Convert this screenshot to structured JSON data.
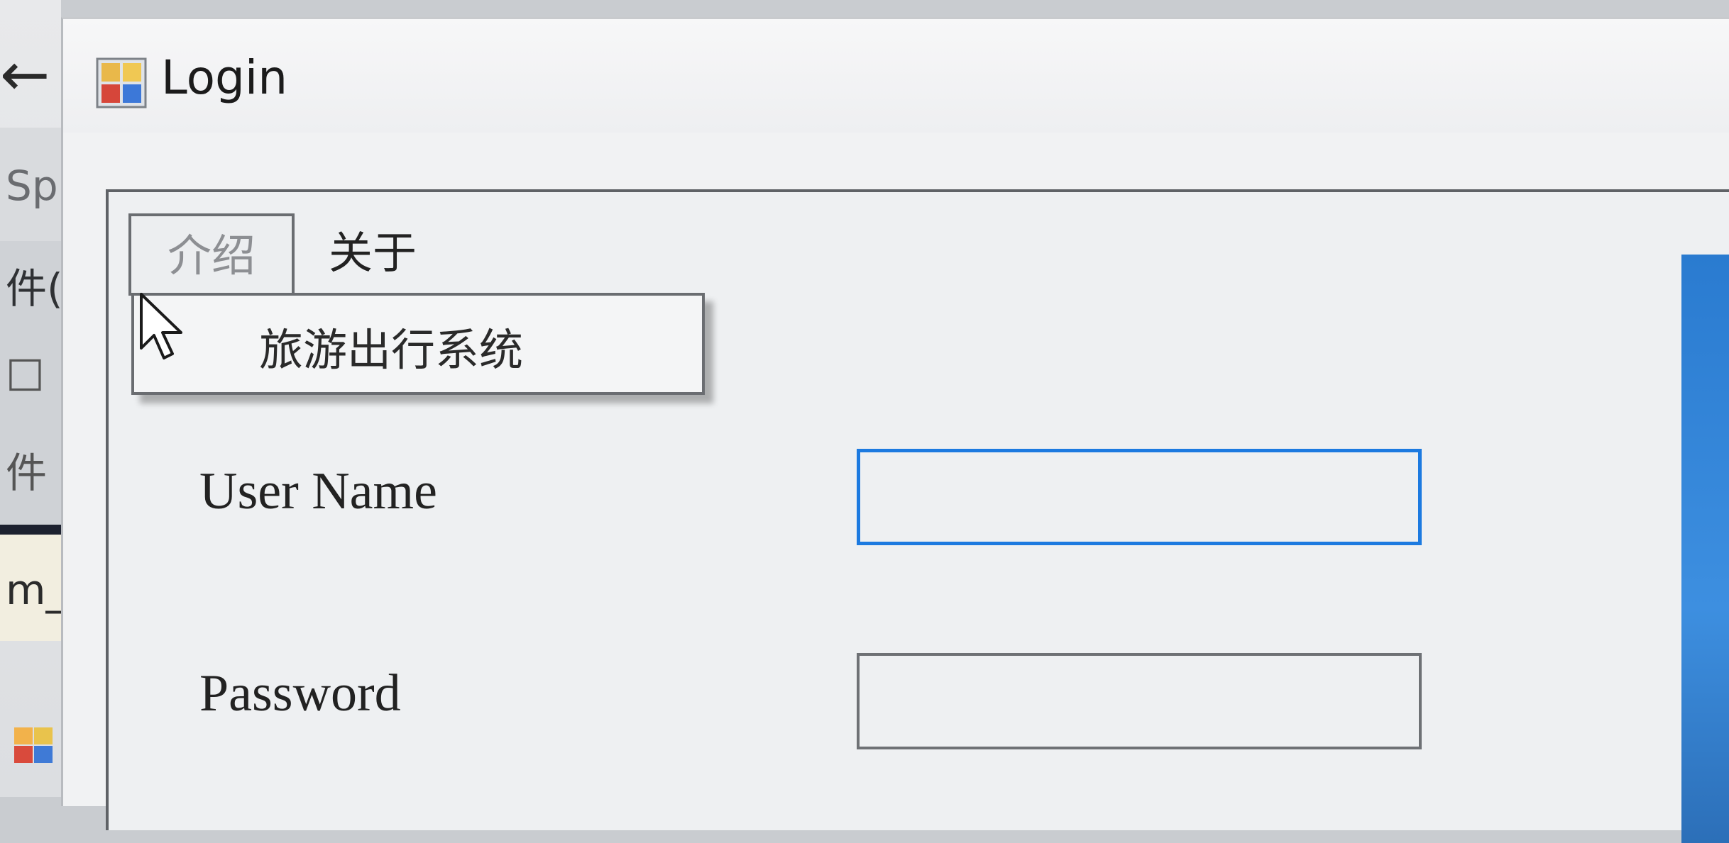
{
  "background_window": {
    "back_glyph": "←",
    "fragments": [
      "Sp",
      "件(F",
      "□",
      "件",
      "m_L"
    ]
  },
  "window": {
    "title": "Login",
    "icon": "app-window-icon"
  },
  "menu": {
    "items": [
      {
        "label": "介绍",
        "state": "open"
      },
      {
        "label": "关于"
      }
    ],
    "dropdown_items": [
      "旅游出行系统"
    ]
  },
  "form": {
    "username_label": "User Name",
    "username_value": "",
    "password_label": "Password",
    "password_value": ""
  },
  "colors": {
    "focus_border": "#1c7ae0",
    "side_panel": "#2a7bd0"
  }
}
